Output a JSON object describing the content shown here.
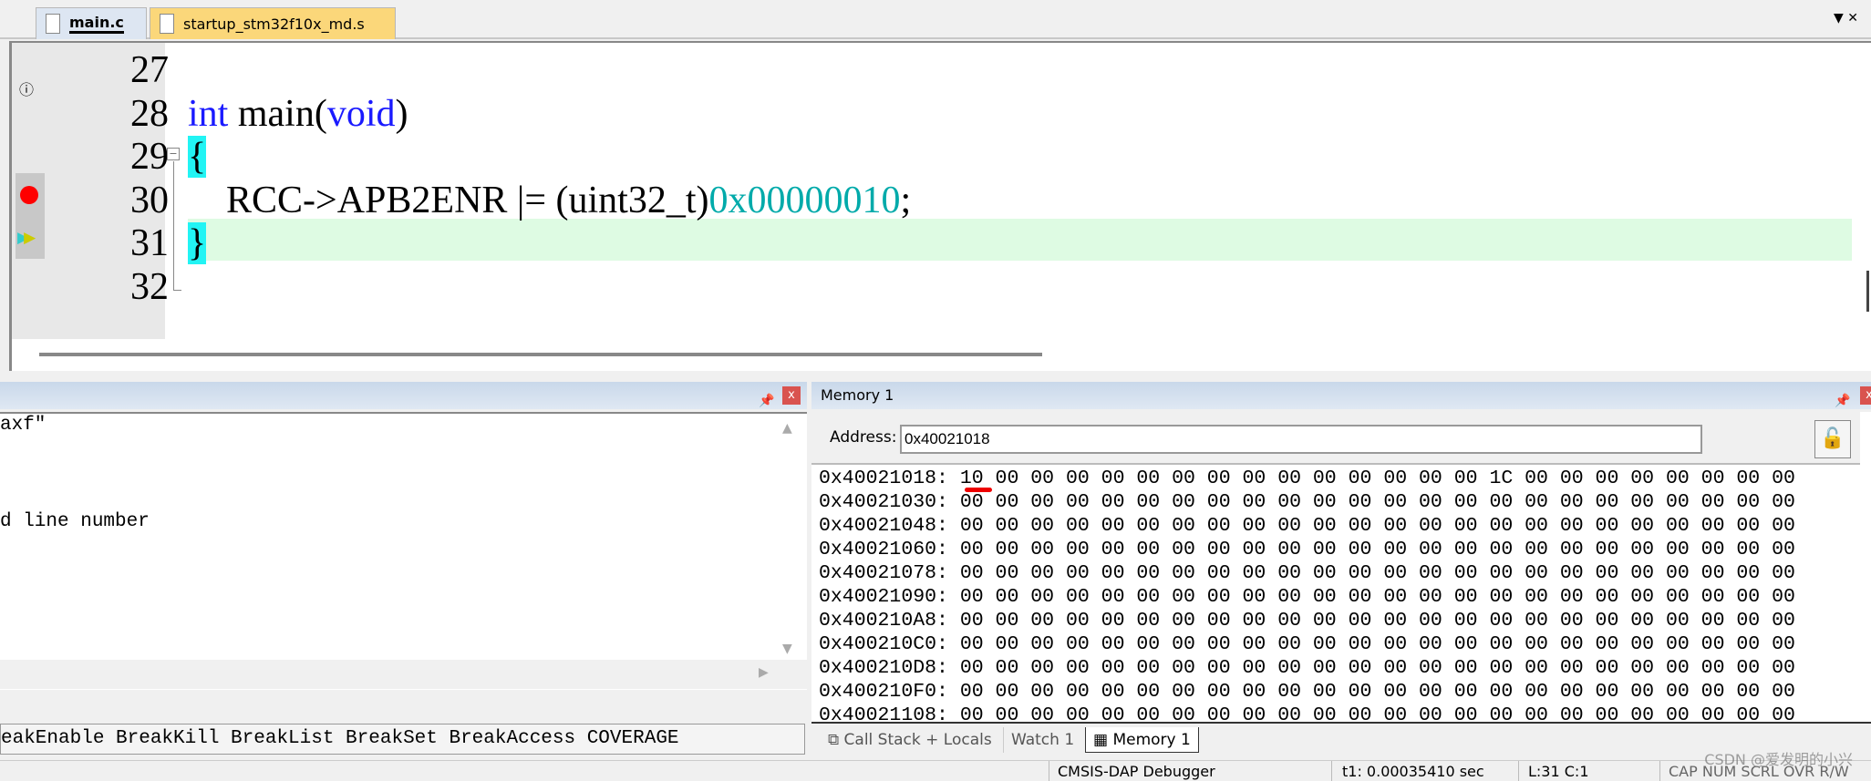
{
  "tabs": [
    {
      "label": "main.c",
      "active": true
    },
    {
      "label": "startup_stm32f10x_md.s",
      "active": false
    }
  ],
  "editor": {
    "lines": [
      {
        "num": "27",
        "code": ""
      },
      {
        "num": "28",
        "code": "int main(void)"
      },
      {
        "num": "29",
        "code": "{"
      },
      {
        "num": "30",
        "code": "RCC->APB2ENR |= (uint32_t)0x00000010;"
      },
      {
        "num": "31",
        "code": "}"
      },
      {
        "num": "32",
        "code": ""
      }
    ],
    "tok": {
      "int": "int",
      "main": " main(",
      "void": "void",
      ")": ")",
      "lbrace": "{",
      "stmt": "    RCC->APB2ENR |= (uint32_t)",
      "hex": "0x00000010",
      ";": ";",
      "rbrace": "}"
    },
    "current_line": "31",
    "breakpoint_line": "30",
    "colors": {
      "current_line_bg": "#defbe3",
      "brace_match": "#22f4f4",
      "keyword": "#1a1aff",
      "number": "#00aaaa",
      "breakpoint": "#ff0000"
    }
  },
  "command_panel": {
    "lines": [
      "axf\"",
      "d line number"
    ],
    "command_hint": "eakEnable BreakKill BreakList BreakSet BreakAccess COVERAGE"
  },
  "memory": {
    "title": "Memory 1",
    "address_label": "Address:",
    "address_value": "0x40021018",
    "rows": [
      {
        "addr": "0x40021018:",
        "bytes": "10 00 00 00 00 00 00 00 00 00 00 00 00 00 00 1C 00 00 00 00 00 00 00 00"
      },
      {
        "addr": "0x40021030:",
        "bytes": "00 00 00 00 00 00 00 00 00 00 00 00 00 00 00 00 00 00 00 00 00 00 00 00"
      },
      {
        "addr": "0x40021048:",
        "bytes": "00 00 00 00 00 00 00 00 00 00 00 00 00 00 00 00 00 00 00 00 00 00 00 00"
      },
      {
        "addr": "0x40021060:",
        "bytes": "00 00 00 00 00 00 00 00 00 00 00 00 00 00 00 00 00 00 00 00 00 00 00 00"
      },
      {
        "addr": "0x40021078:",
        "bytes": "00 00 00 00 00 00 00 00 00 00 00 00 00 00 00 00 00 00 00 00 00 00 00 00"
      },
      {
        "addr": "0x40021090:",
        "bytes": "00 00 00 00 00 00 00 00 00 00 00 00 00 00 00 00 00 00 00 00 00 00 00 00"
      },
      {
        "addr": "0x400210A8:",
        "bytes": "00 00 00 00 00 00 00 00 00 00 00 00 00 00 00 00 00 00 00 00 00 00 00 00"
      },
      {
        "addr": "0x400210C0:",
        "bytes": "00 00 00 00 00 00 00 00 00 00 00 00 00 00 00 00 00 00 00 00 00 00 00 00"
      },
      {
        "addr": "0x400210D8:",
        "bytes": "00 00 00 00 00 00 00 00 00 00 00 00 00 00 00 00 00 00 00 00 00 00 00 00"
      },
      {
        "addr": "0x400210F0:",
        "bytes": "00 00 00 00 00 00 00 00 00 00 00 00 00 00 00 00 00 00 00 00 00 00 00 00"
      },
      {
        "addr": "0x40021108:",
        "bytes": "00 00 00 00 00 00 00 00 00 00 00 00 00 00 00 00 00 00 00 00 00 00 00 00"
      }
    ]
  },
  "bottom_tabs": [
    {
      "label": "Call Stack + Locals"
    },
    {
      "label": "Watch 1"
    },
    {
      "label": "Memory 1",
      "active": true
    }
  ],
  "status": {
    "debugger": "CMSIS-DAP Debugger",
    "time": "t1: 0.00035410 sec",
    "position": "L:31 C:1",
    "indicators": "CAP NUM SCRL OVR R/W"
  },
  "watermark": "CSDN @爱发明的小兴"
}
